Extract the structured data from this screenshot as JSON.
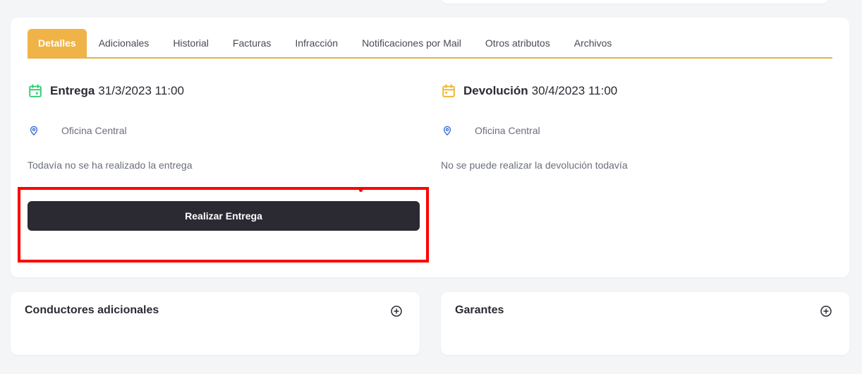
{
  "tabs": [
    {
      "label": "Detalles",
      "active": true
    },
    {
      "label": "Adicionales"
    },
    {
      "label": "Historial"
    },
    {
      "label": "Facturas"
    },
    {
      "label": "Infracción"
    },
    {
      "label": "Notificaciones por Mail"
    },
    {
      "label": "Otros atributos"
    },
    {
      "label": "Archivos"
    }
  ],
  "delivery": {
    "label": "Entrega",
    "datetime": "31/3/2023 11:00",
    "location": "Oficina Central",
    "status": "Todavía no se ha realizado la entrega",
    "button_label": "Realizar Entrega",
    "icon": "calendar-icon",
    "color": "#2ecc71"
  },
  "return": {
    "label": "Devolución",
    "datetime": "30/4/2023 11:00",
    "location": "Oficina Central",
    "status": "No se puede realizar la devolución todavía",
    "icon": "calendar-icon",
    "color": "#f0b429"
  },
  "cards": {
    "drivers_title": "Conductores adicionales",
    "guarantors_title": "Garantes"
  },
  "colors": {
    "accent": "#f0b347",
    "button": "#2b2a33",
    "highlight": "#ff0000",
    "location_icon": "#3b6fd8"
  }
}
